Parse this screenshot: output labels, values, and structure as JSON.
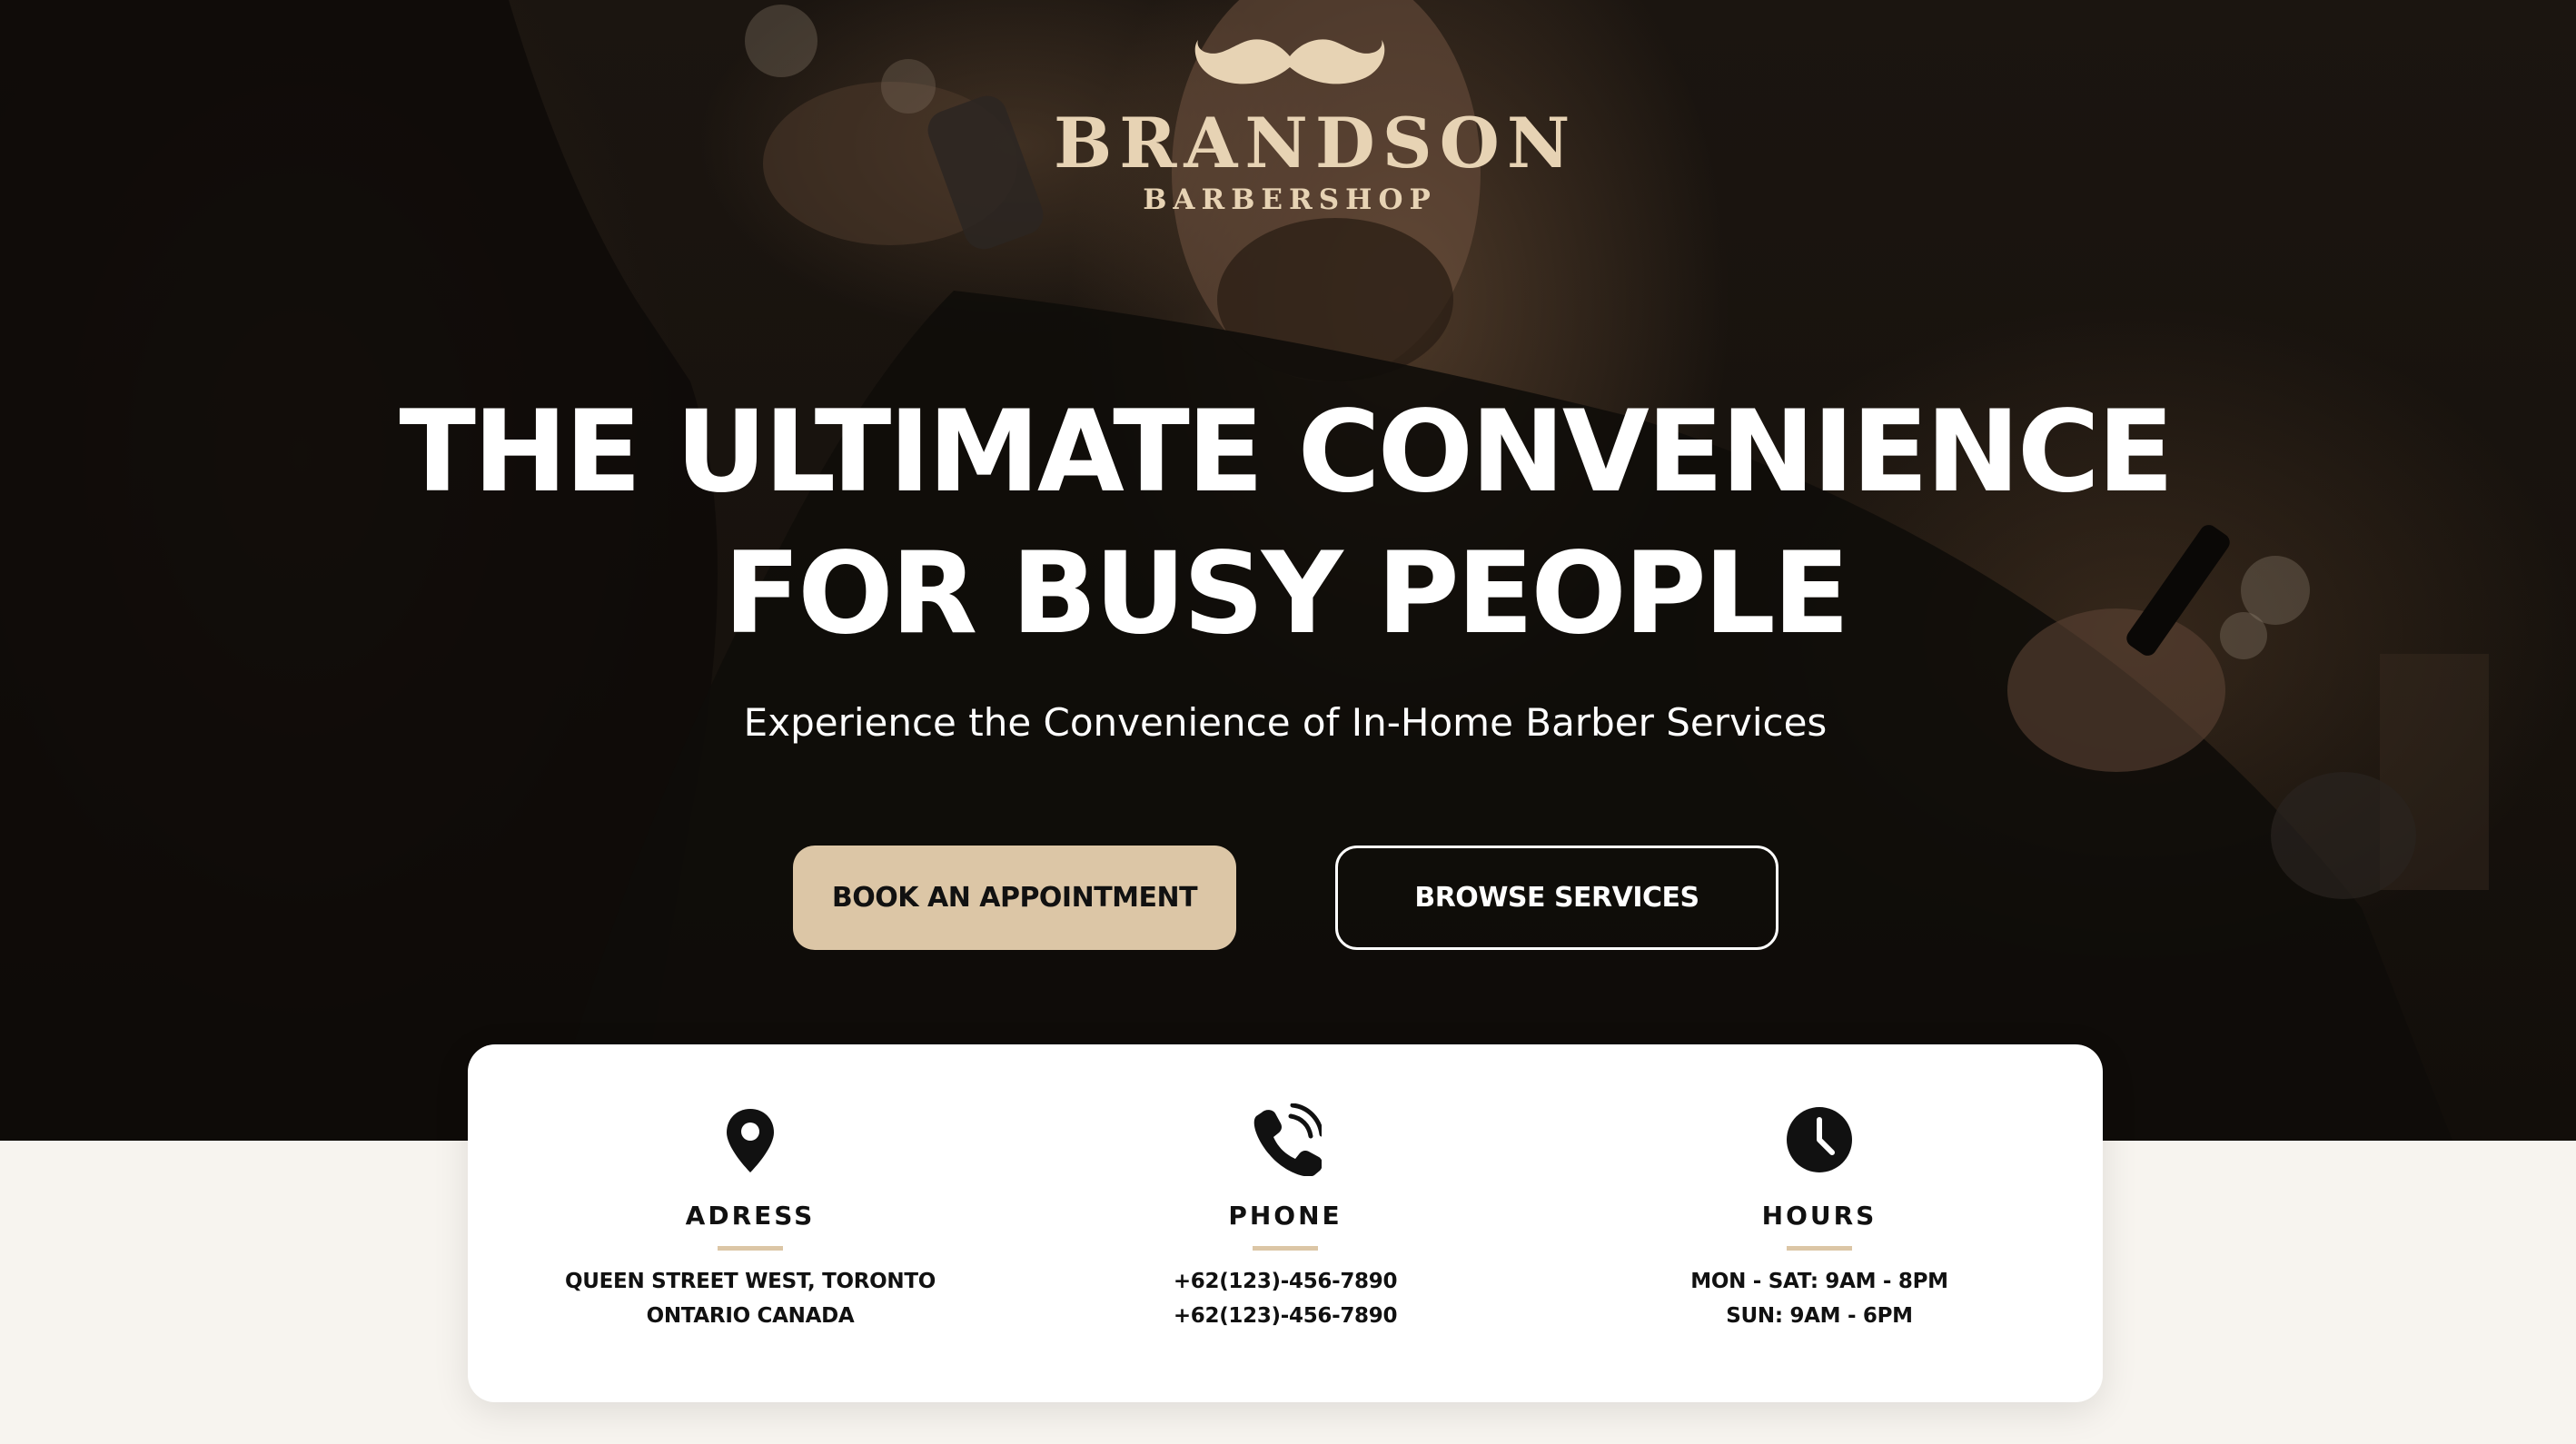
{
  "brand": {
    "name": "BRANDSON",
    "subtitle": "BARBERSHOP"
  },
  "hero": {
    "headline_line1": "THE ULTIMATE CONVENIENCE",
    "headline_line2": "FOR BUSY PEOPLE",
    "subheadline": "Experience the Convenience of In-Home Barber Services",
    "primary_button": "BOOK AN APPOINTMENT",
    "secondary_button": "BROWSE SERVICES"
  },
  "info": {
    "address": {
      "icon": "map-pin-icon",
      "title": "ADRESS",
      "line1": "QUEEN STREET WEST, TORONTO",
      "line2": "ONTARIO CANADA"
    },
    "phone": {
      "icon": "phone-ringing-icon",
      "title": "PHONE",
      "line1": "+62(123)-456-7890",
      "line2": "+62(123)-456-7890"
    },
    "hours": {
      "icon": "clock-icon",
      "title": "HOURS",
      "line1": "MON - SAT: 9AM - 8PM",
      "line2": "SUN: 9AM - 6PM"
    }
  },
  "colors": {
    "accent": "#dcc6a6",
    "logo": "#e7d3b4",
    "hero_dark": "#17120d",
    "page_bg": "#f7f4ef"
  }
}
